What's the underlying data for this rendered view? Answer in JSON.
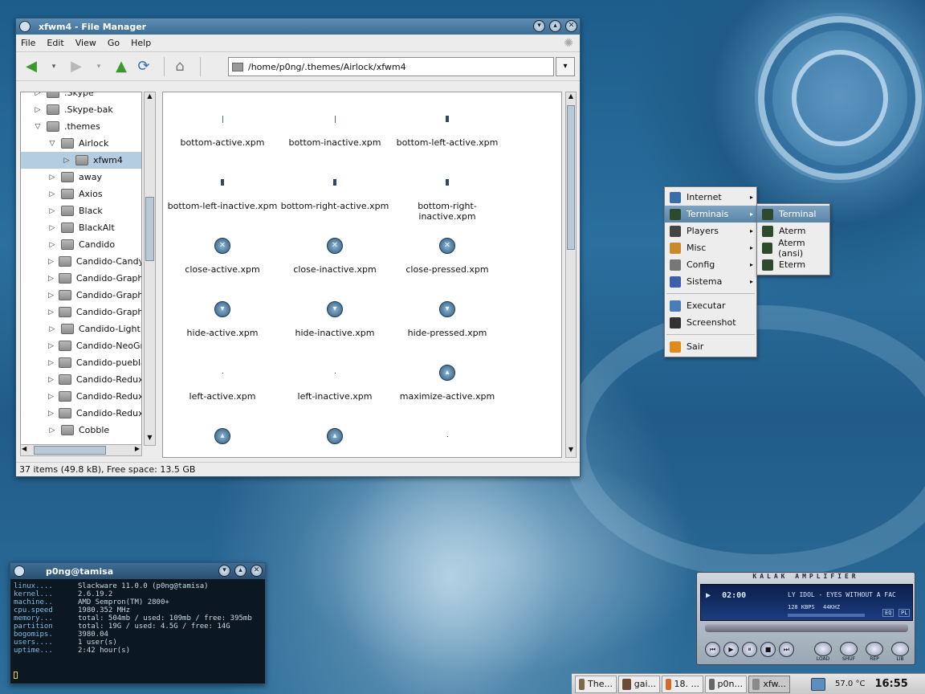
{
  "desktop": {
    "colors": {
      "accent": "#3c6d95"
    }
  },
  "filemanager": {
    "title": "xfwm4 - File Manager",
    "menu": [
      "File",
      "Edit",
      "View",
      "Go",
      "Help"
    ],
    "path": "/home/p0ng/.themes/Airlock/xfwm4",
    "tree": [
      {
        "label": ".Skype",
        "depth": 1,
        "state": "closed"
      },
      {
        "label": ".Skype-bak",
        "depth": 1,
        "state": "closed"
      },
      {
        "label": ".themes",
        "depth": 1,
        "state": "open"
      },
      {
        "label": "Airlock",
        "depth": 2,
        "state": "open"
      },
      {
        "label": "xfwm4",
        "depth": 3,
        "state": "closed",
        "selected": true
      },
      {
        "label": "away",
        "depth": 2,
        "state": "closed"
      },
      {
        "label": "Axios",
        "depth": 2,
        "state": "closed"
      },
      {
        "label": "Black",
        "depth": 2,
        "state": "closed"
      },
      {
        "label": "BlackAlt",
        "depth": 2,
        "state": "closed"
      },
      {
        "label": "Candido",
        "depth": 2,
        "state": "closed"
      },
      {
        "label": "Candido-Candy",
        "depth": 2,
        "state": "closed"
      },
      {
        "label": "Candido-Graph",
        "depth": 2,
        "state": "closed"
      },
      {
        "label": "Candido-Graph",
        "depth": 2,
        "state": "closed"
      },
      {
        "label": "Candido-Graph",
        "depth": 2,
        "state": "closed"
      },
      {
        "label": "Candido-Light",
        "depth": 2,
        "state": "closed"
      },
      {
        "label": "Candido-NeoGr",
        "depth": 2,
        "state": "closed"
      },
      {
        "label": "Candido-puebla",
        "depth": 2,
        "state": "closed"
      },
      {
        "label": "Candido-Redux",
        "depth": 2,
        "state": "closed"
      },
      {
        "label": "Candido-Redux",
        "depth": 2,
        "state": "closed"
      },
      {
        "label": "Candido-Redux",
        "depth": 2,
        "state": "closed"
      },
      {
        "label": "Cobble",
        "depth": 2,
        "state": "closed"
      }
    ],
    "files": [
      {
        "name": "bottom-active.xpm",
        "kind": "line"
      },
      {
        "name": "bottom-inactive.xpm",
        "kind": "line"
      },
      {
        "name": "bottom-left-active.xpm",
        "kind": "small"
      },
      {
        "name": "bottom-left-inactive.xpm",
        "kind": "small"
      },
      {
        "name": "bottom-right-active.xpm",
        "kind": "small"
      },
      {
        "name": "bottom-right-inactive.xpm",
        "kind": "small"
      },
      {
        "name": "close-active.xpm",
        "kind": "close"
      },
      {
        "name": "close-inactive.xpm",
        "kind": "close"
      },
      {
        "name": "close-pressed.xpm",
        "kind": "close"
      },
      {
        "name": "hide-active.xpm",
        "kind": "hide"
      },
      {
        "name": "hide-inactive.xpm",
        "kind": "hide"
      },
      {
        "name": "hide-pressed.xpm",
        "kind": "hide"
      },
      {
        "name": "left-active.xpm",
        "kind": "dot"
      },
      {
        "name": "left-inactive.xpm",
        "kind": "dot"
      },
      {
        "name": "maximize-active.xpm",
        "kind": "max"
      },
      {
        "name": "",
        "kind": "btn"
      },
      {
        "name": "",
        "kind": "btn"
      },
      {
        "name": "",
        "kind": "dot"
      }
    ],
    "status": "37 items (49.8 kB), Free space: 13.5 GB"
  },
  "menu": {
    "items": [
      {
        "label": "Internet",
        "icon": "globe-icon",
        "color": "#3a6ea8",
        "submenu": true
      },
      {
        "label": "Terminais",
        "icon": "terminal-icon",
        "color": "#2d4a2d",
        "submenu": true,
        "highlight": true
      },
      {
        "label": "Players",
        "icon": "film-icon",
        "color": "#444444",
        "submenu": true
      },
      {
        "label": "Misc",
        "icon": "box-icon",
        "color": "#c88a2c",
        "submenu": true
      },
      {
        "label": "Config",
        "icon": "tools-icon",
        "color": "#777777",
        "submenu": true
      },
      {
        "label": "Sistema",
        "icon": "monitor-icon",
        "color": "#3b5fa8",
        "submenu": true
      }
    ],
    "extra": [
      {
        "label": "Executar",
        "icon": "gear-icon",
        "color": "#4a7db8"
      },
      {
        "label": "Screenshot",
        "icon": "camera-icon",
        "color": "#333333"
      }
    ],
    "quit": {
      "label": "Sair",
      "icon": "power-icon",
      "color": "#e08a1a"
    },
    "submenu": [
      {
        "label": "Terminal",
        "highlight": true
      },
      {
        "label": "Aterm"
      },
      {
        "label": "Aterm (ansi)"
      },
      {
        "label": "Eterm"
      }
    ]
  },
  "terminal": {
    "title": "p0ng@tamisa",
    "labels": [
      "linux....",
      "kernel...",
      "machine..",
      "cpu.speed",
      "memory...",
      "partition",
      "bogomips.",
      "users....",
      "uptime..."
    ],
    "values": [
      "Slackware 11.0.0 (p0ng@tamisa)",
      "2.6.19.2",
      "AMD Sempron(TM) 2800+",
      "1980.352 MHz",
      "total: 504mb / used: 109mb / free: 395mb",
      "total: 19G / used: 4.5G / free: 14G",
      "3980.04",
      "1 user(s)",
      "2:42 hour(s)"
    ]
  },
  "xmms": {
    "title": "KALAK AMPLIFIER",
    "time": "02:00",
    "track": "LY IDOL - EYES WITHOUT A FAC",
    "bitrate": "128 KBPS",
    "samplerate": "44KHZ",
    "labels": [
      "LOAD",
      "SHUF",
      "REP",
      "LIB"
    ],
    "eq": "EQ",
    "pl": "PL"
  },
  "taskbar": {
    "tasks": [
      {
        "label": "The...",
        "color": "#7a6a4a"
      },
      {
        "label": "gai...",
        "color": "#6b4a3a"
      },
      {
        "label": "18. ...",
        "color": "#d46a2a"
      },
      {
        "label": "p0n...",
        "color": "#666666"
      },
      {
        "label": "xfw...",
        "color": "#8a8a8a",
        "active": true
      }
    ],
    "temp": "57.0 °C",
    "clock": "16:55"
  }
}
